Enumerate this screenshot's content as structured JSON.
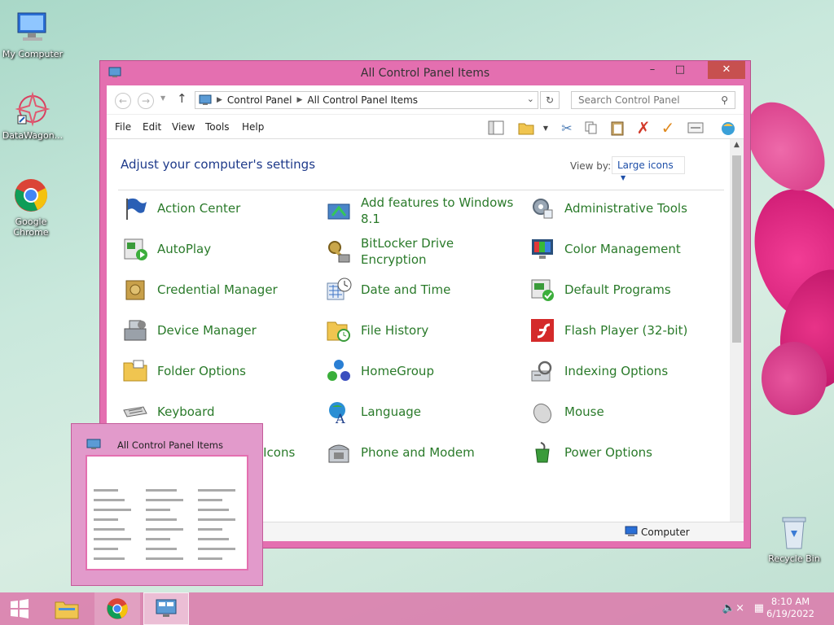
{
  "desktop": {
    "icons": [
      {
        "label": "My Computer"
      },
      {
        "label": "DataWagon..."
      },
      {
        "label": "Google Chrome"
      },
      {
        "label": "Recycle Bin"
      }
    ]
  },
  "window": {
    "title": "All Control Panel Items",
    "address": {
      "crumb1": "Control Panel",
      "crumb2": "All Control Panel Items"
    },
    "search_placeholder": "Search Control Panel",
    "menu": [
      "File",
      "Edit",
      "View",
      "Tools",
      "Help"
    ],
    "heading": "Adjust your computer's settings",
    "view_by_label": "View by:",
    "view_by_value": "Large icons",
    "items": [
      {
        "label": "Action Center",
        "icon": "flag-icon"
      },
      {
        "label": "Add features to Windows 8.1",
        "icon": "add-features-icon"
      },
      {
        "label": "Administrative Tools",
        "icon": "admin-tools-icon"
      },
      {
        "label": "AutoPlay",
        "icon": "autoplay-icon"
      },
      {
        "label": "BitLocker Drive Encryption",
        "icon": "bitlocker-icon"
      },
      {
        "label": "Color Management",
        "icon": "color-management-icon"
      },
      {
        "label": "Credential Manager",
        "icon": "credential-icon"
      },
      {
        "label": "Date and Time",
        "icon": "clock-icon"
      },
      {
        "label": "Default Programs",
        "icon": "default-programs-icon"
      },
      {
        "label": "Device Manager",
        "icon": "device-manager-icon"
      },
      {
        "label": "File History",
        "icon": "file-history-icon"
      },
      {
        "label": "Flash Player (32-bit)",
        "icon": "flash-icon"
      },
      {
        "label": "Folder Options",
        "icon": "folder-icon"
      },
      {
        "label": "HomeGroup",
        "icon": "homegroup-icon"
      },
      {
        "label": "Indexing Options",
        "icon": "indexing-icon"
      },
      {
        "label": "Keyboard",
        "icon": "keyboard-icon"
      },
      {
        "label": "Language",
        "icon": "language-icon"
      },
      {
        "label": "Mouse",
        "icon": "mouse-icon"
      },
      {
        "label": "Notification Area Icons",
        "icon": "notification-icon"
      },
      {
        "label": "Phone and Modem",
        "icon": "phone-icon"
      },
      {
        "label": "Power Options",
        "icon": "power-icon"
      }
    ],
    "status": "Computer"
  },
  "thumbnail": {
    "title": "All Control Panel Items"
  },
  "taskbar": {
    "time": "8:10 AM",
    "date": "6/19/2022"
  }
}
